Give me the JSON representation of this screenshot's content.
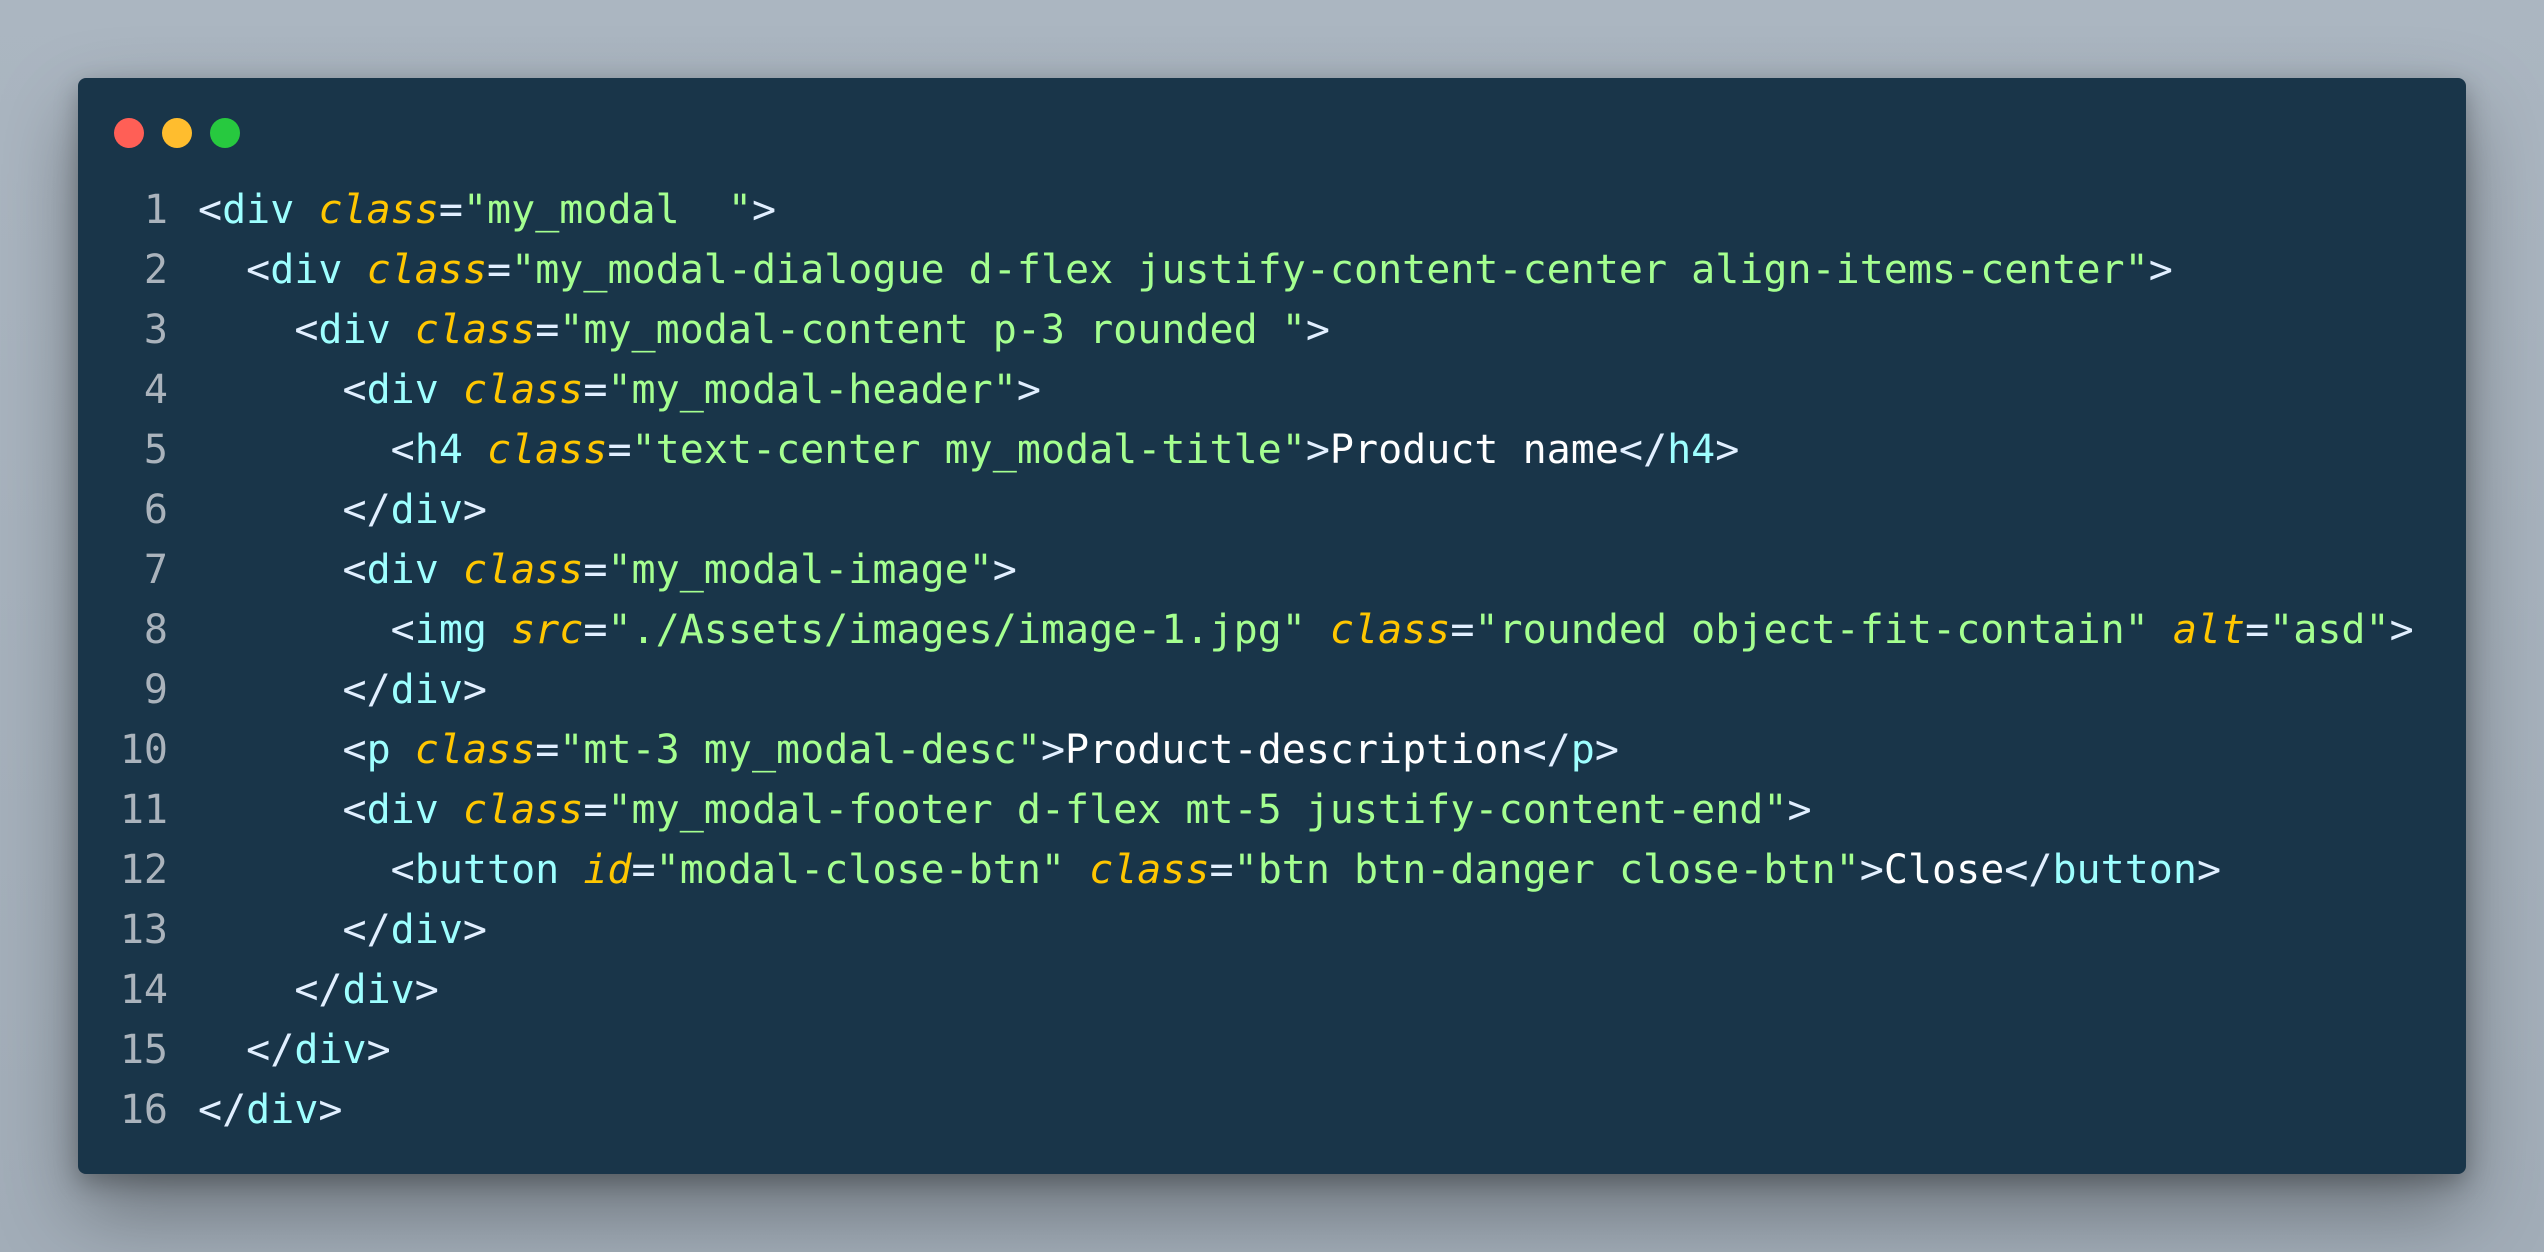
{
  "window": {
    "controls": {
      "close_color": "#ff5f56",
      "minimize_color": "#ffbd2e",
      "maximize_color": "#27c93f"
    }
  },
  "theme": {
    "background": "#193549",
    "punctuation": "#e1efff",
    "tag": "#9effff",
    "attribute": "#ffc600",
    "string": "#a5ff90",
    "text": "#ffffff",
    "line_number": "#aab3bc"
  },
  "code": {
    "language": "html",
    "lines": [
      {
        "n": "1",
        "indent": "",
        "tokens": [
          [
            "p",
            "<"
          ],
          [
            "tag",
            "div"
          ],
          [
            "txt",
            " "
          ],
          [
            "attr",
            "class"
          ],
          [
            "p",
            "="
          ],
          [
            "str",
            "\"my_modal  \""
          ],
          [
            "p",
            ">"
          ]
        ]
      },
      {
        "n": "2",
        "indent": "  ",
        "tokens": [
          [
            "p",
            "<"
          ],
          [
            "tag",
            "div"
          ],
          [
            "txt",
            " "
          ],
          [
            "attr",
            "class"
          ],
          [
            "p",
            "="
          ],
          [
            "str",
            "\"my_modal-dialogue d-flex justify-content-center align-items-center\""
          ],
          [
            "p",
            ">"
          ]
        ]
      },
      {
        "n": "3",
        "indent": "    ",
        "tokens": [
          [
            "p",
            "<"
          ],
          [
            "tag",
            "div"
          ],
          [
            "txt",
            " "
          ],
          [
            "attr",
            "class"
          ],
          [
            "p",
            "="
          ],
          [
            "str",
            "\"my_modal-content p-3 rounded \""
          ],
          [
            "p",
            ">"
          ]
        ]
      },
      {
        "n": "4",
        "indent": "      ",
        "tokens": [
          [
            "p",
            "<"
          ],
          [
            "tag",
            "div"
          ],
          [
            "txt",
            " "
          ],
          [
            "attr",
            "class"
          ],
          [
            "p",
            "="
          ],
          [
            "str",
            "\"my_modal-header\""
          ],
          [
            "p",
            ">"
          ]
        ]
      },
      {
        "n": "5",
        "indent": "        ",
        "tokens": [
          [
            "p",
            "<"
          ],
          [
            "tag",
            "h4"
          ],
          [
            "txt",
            " "
          ],
          [
            "attr",
            "class"
          ],
          [
            "p",
            "="
          ],
          [
            "str",
            "\"text-center my_modal-title\""
          ],
          [
            "p",
            ">"
          ],
          [
            "txt",
            "Product name"
          ],
          [
            "p",
            "</"
          ],
          [
            "tag",
            "h4"
          ],
          [
            "p",
            ">"
          ]
        ]
      },
      {
        "n": "6",
        "indent": "      ",
        "tokens": [
          [
            "p",
            "</"
          ],
          [
            "tag",
            "div"
          ],
          [
            "p",
            ">"
          ]
        ]
      },
      {
        "n": "7",
        "indent": "      ",
        "tokens": [
          [
            "p",
            "<"
          ],
          [
            "tag",
            "div"
          ],
          [
            "txt",
            " "
          ],
          [
            "attr",
            "class"
          ],
          [
            "p",
            "="
          ],
          [
            "str",
            "\"my_modal-image\""
          ],
          [
            "p",
            ">"
          ]
        ]
      },
      {
        "n": "8",
        "indent": "        ",
        "tokens": [
          [
            "p",
            "<"
          ],
          [
            "tag",
            "img"
          ],
          [
            "txt",
            " "
          ],
          [
            "attr",
            "src"
          ],
          [
            "p",
            "="
          ],
          [
            "str",
            "\"./Assets/images/image-1.jpg\""
          ],
          [
            "txt",
            " "
          ],
          [
            "attr",
            "class"
          ],
          [
            "p",
            "="
          ],
          [
            "str",
            "\"rounded object-fit-contain\""
          ],
          [
            "txt",
            " "
          ],
          [
            "attr",
            "alt"
          ],
          [
            "p",
            "="
          ],
          [
            "str",
            "\"asd\""
          ],
          [
            "p",
            ">"
          ]
        ]
      },
      {
        "n": "9",
        "indent": "      ",
        "tokens": [
          [
            "p",
            "</"
          ],
          [
            "tag",
            "div"
          ],
          [
            "p",
            ">"
          ]
        ]
      },
      {
        "n": "10",
        "indent": "      ",
        "tokens": [
          [
            "p",
            "<"
          ],
          [
            "tag",
            "p"
          ],
          [
            "txt",
            " "
          ],
          [
            "attr",
            "class"
          ],
          [
            "p",
            "="
          ],
          [
            "str",
            "\"mt-3 my_modal-desc\""
          ],
          [
            "p",
            ">"
          ],
          [
            "txt",
            "Product-description"
          ],
          [
            "p",
            "</"
          ],
          [
            "tag",
            "p"
          ],
          [
            "p",
            ">"
          ]
        ]
      },
      {
        "n": "11",
        "indent": "      ",
        "tokens": [
          [
            "p",
            "<"
          ],
          [
            "tag",
            "div"
          ],
          [
            "txt",
            " "
          ],
          [
            "attr",
            "class"
          ],
          [
            "p",
            "="
          ],
          [
            "str",
            "\"my_modal-footer d-flex mt-5 justify-content-end\""
          ],
          [
            "p",
            ">"
          ]
        ]
      },
      {
        "n": "12",
        "indent": "        ",
        "tokens": [
          [
            "p",
            "<"
          ],
          [
            "tag",
            "button"
          ],
          [
            "txt",
            " "
          ],
          [
            "attr",
            "id"
          ],
          [
            "p",
            "="
          ],
          [
            "str",
            "\"modal-close-btn\""
          ],
          [
            "txt",
            " "
          ],
          [
            "attr",
            "class"
          ],
          [
            "p",
            "="
          ],
          [
            "str",
            "\"btn btn-danger close-btn\""
          ],
          [
            "p",
            ">"
          ],
          [
            "txt",
            "Close"
          ],
          [
            "p",
            "</"
          ],
          [
            "tag",
            "button"
          ],
          [
            "p",
            ">"
          ]
        ]
      },
      {
        "n": "13",
        "indent": "      ",
        "tokens": [
          [
            "p",
            "</"
          ],
          [
            "tag",
            "div"
          ],
          [
            "p",
            ">"
          ]
        ]
      },
      {
        "n": "14",
        "indent": "    ",
        "tokens": [
          [
            "p",
            "</"
          ],
          [
            "tag",
            "div"
          ],
          [
            "p",
            ">"
          ]
        ]
      },
      {
        "n": "15",
        "indent": "  ",
        "tokens": [
          [
            "p",
            "</"
          ],
          [
            "tag",
            "div"
          ],
          [
            "p",
            ">"
          ]
        ]
      },
      {
        "n": "16",
        "indent": "",
        "tokens": [
          [
            "p",
            "</"
          ],
          [
            "tag",
            "div"
          ],
          [
            "p",
            ">"
          ]
        ]
      }
    ]
  }
}
